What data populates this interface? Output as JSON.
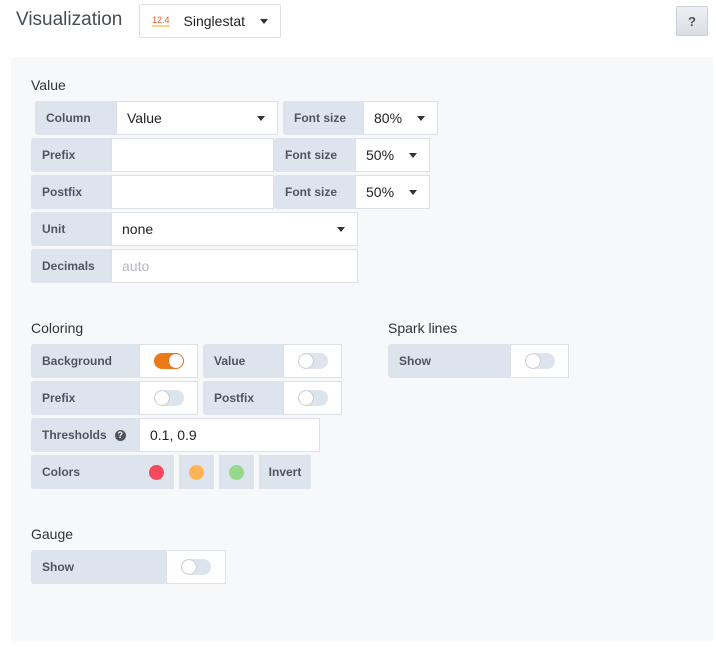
{
  "header": {
    "title": "Visualization",
    "viz_icon": "12.4",
    "viz_name": "Singlestat",
    "help": "?"
  },
  "value": {
    "title": "Value",
    "column_label": "Column",
    "column_value": "Value",
    "font_size_label": "Font size",
    "font_size_value": "80%",
    "prefix_label": "Prefix",
    "prefix_value": "",
    "prefix_font_label": "Font size",
    "prefix_font_value": "50%",
    "postfix_label": "Postfix",
    "postfix_value": "",
    "postfix_font_label": "Font size",
    "postfix_font_value": "50%",
    "unit_label": "Unit",
    "unit_value": "none",
    "decimals_label": "Decimals",
    "decimals_placeholder": "auto"
  },
  "coloring": {
    "title": "Coloring",
    "background_label": "Background",
    "background_on": true,
    "value_label": "Value",
    "value_on": false,
    "prefix_label": "Prefix",
    "prefix_on": false,
    "postfix_label": "Postfix",
    "postfix_on": false,
    "thresholds_label": "Thresholds",
    "thresholds_value": "0.1, 0.9",
    "colors_label": "Colors",
    "colors": [
      "#f2495c",
      "#ffb357",
      "#96d98d"
    ],
    "invert_label": "Invert"
  },
  "spark": {
    "title": "Spark lines",
    "show_label": "Show",
    "show_on": false
  },
  "gauge": {
    "title": "Gauge",
    "show_label": "Show",
    "show_on": false
  }
}
